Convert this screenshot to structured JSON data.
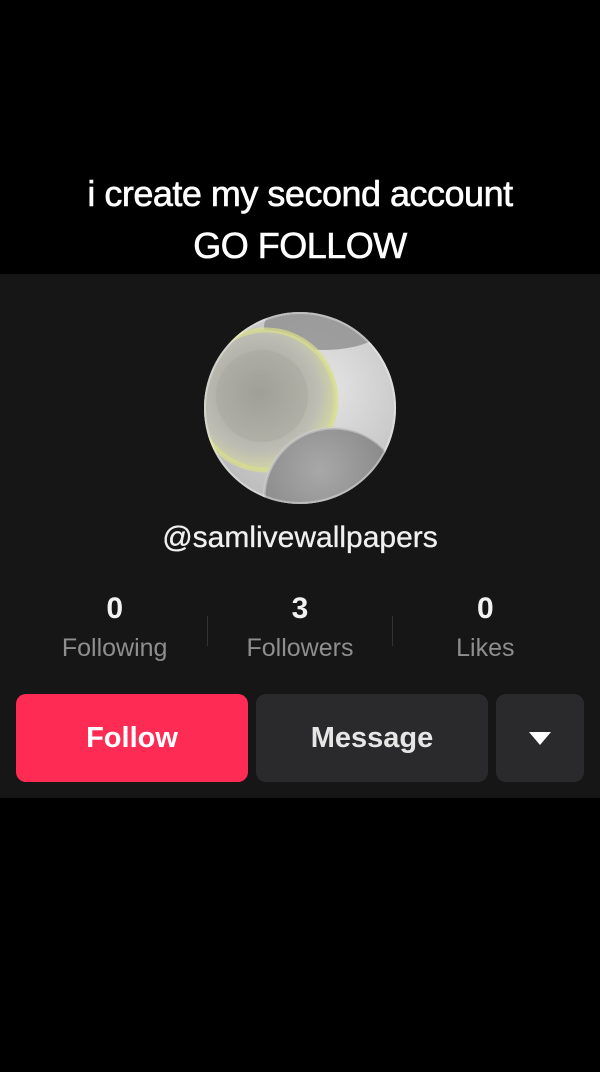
{
  "caption": {
    "line1": "i create my second account",
    "line2": "GO FOLLOW"
  },
  "profile": {
    "avatar_icon": "profile-avatar-image",
    "handle": "@samlivewallpapers",
    "stats": [
      {
        "value": "0",
        "label": "Following"
      },
      {
        "value": "3",
        "label": "Followers"
      },
      {
        "value": "0",
        "label": "Likes"
      }
    ]
  },
  "actions": {
    "follow_label": "Follow",
    "message_label": "Message",
    "more_icon": "chevron-down-icon"
  },
  "colors": {
    "background": "#000000",
    "card": "#161616",
    "follow": "#fe2c55",
    "secondary_button": "#2a2a2c",
    "muted_text": "#8e8e8e"
  }
}
